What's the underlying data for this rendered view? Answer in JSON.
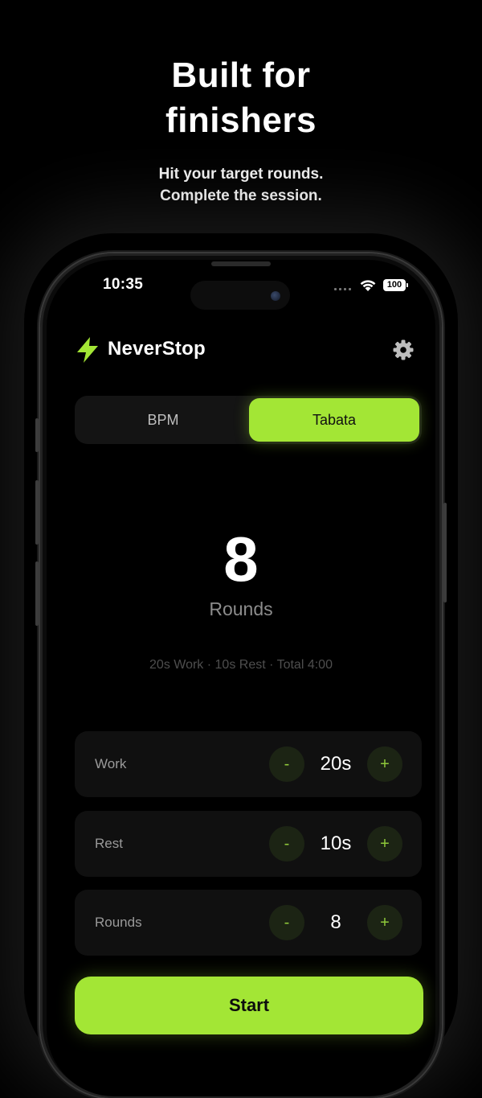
{
  "promo": {
    "headline_line1": "Built for",
    "headline_line2": "finishers",
    "subhead_line1": "Hit your target rounds.",
    "subhead_line2": "Complete the session."
  },
  "status_bar": {
    "time": "10:35",
    "battery": "100"
  },
  "header": {
    "app_name": "NeverStop",
    "logo_icon": "lightning-bolt-icon",
    "settings_icon": "gear-icon"
  },
  "mode_tabs": [
    {
      "label": "BPM",
      "selected": false
    },
    {
      "label": "Tabata",
      "selected": true
    }
  ],
  "display": {
    "value": "8",
    "label": "Rounds",
    "summary": "20s Work · 10s Rest · Total 4:00"
  },
  "settings_rows": [
    {
      "label": "Work",
      "value": "20s",
      "minus": "-",
      "plus": "+"
    },
    {
      "label": "Rest",
      "value": "10s",
      "minus": "-",
      "plus": "+"
    },
    {
      "label": "Rounds",
      "value": "8",
      "minus": "-",
      "plus": "+"
    }
  ],
  "start_label": "Start",
  "colors": {
    "accent": "#a3e635",
    "background": "#000000",
    "card": "#101010"
  }
}
